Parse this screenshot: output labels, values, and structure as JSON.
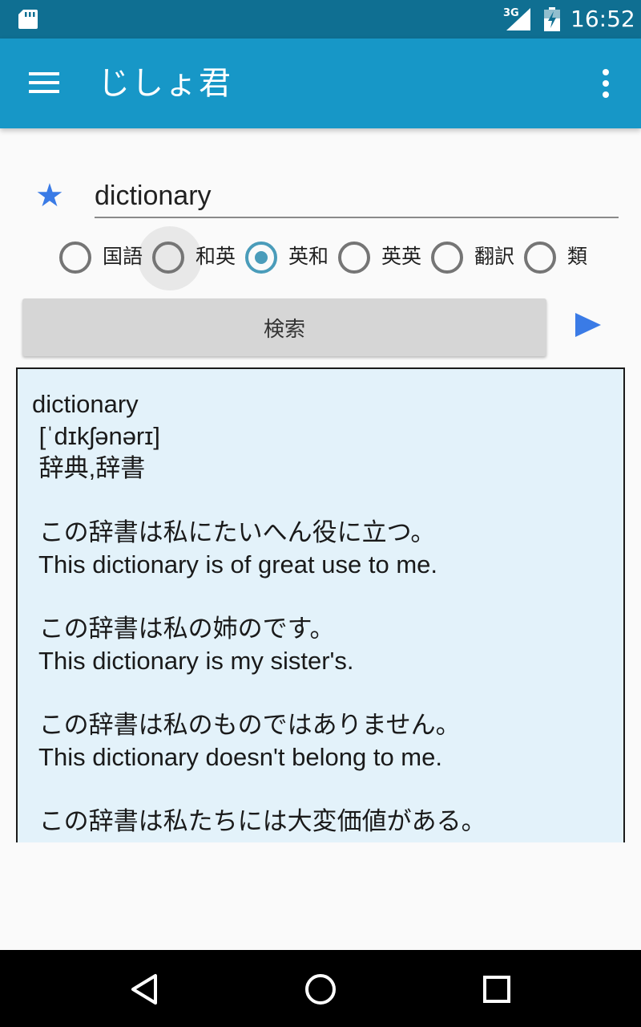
{
  "status_bar": {
    "network": "3G",
    "time": "16:52",
    "icons": [
      "sd-card-icon",
      "signal-icon",
      "battery-icon"
    ]
  },
  "app_bar": {
    "title": "じしょ君",
    "menu_icon": "hamburger-menu-icon",
    "overflow_icon": "more-vert-icon"
  },
  "search": {
    "favorite_icon": "star-icon",
    "value": "dictionary",
    "accent_color": "#3a7be6"
  },
  "modes": {
    "selected": "英和",
    "options": [
      {
        "label": "国語",
        "checked": false
      },
      {
        "label": "和英",
        "checked": false
      },
      {
        "label": "英和",
        "checked": true
      },
      {
        "label": "英英",
        "checked": false
      },
      {
        "label": "翻訳",
        "checked": false
      },
      {
        "label": "類",
        "checked": false
      }
    ]
  },
  "actions": {
    "search_label": "検索",
    "play_icon": "play-icon"
  },
  "result": {
    "lines": [
      "dictionary",
      " [ˈdɪkʃənərɪ]",
      " 辞典,辞書",
      "",
      " この辞書は私にたいへん役に立つ。",
      " This dictionary is of great use to me.",
      "",
      " この辞書は私の姉のです。",
      " This dictionary is my sister's.",
      "",
      " この辞書は私のものではありません。",
      " This dictionary doesn't belong to me.",
      "",
      " この辞書は私たちには大変価値がある。"
    ]
  },
  "colors": {
    "status_bar": "#0f6f92",
    "app_bar": "#1797c7",
    "radio_checked": "#4a9cba",
    "result_background": "#e3f2fa"
  },
  "nav_bar": {
    "icons": [
      "back-icon",
      "home-icon",
      "recents-icon"
    ]
  }
}
